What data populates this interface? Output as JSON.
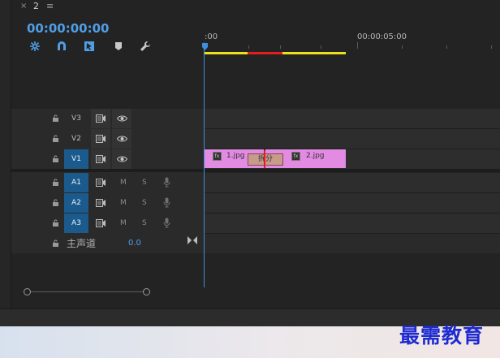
{
  "panel": {
    "close_glyph": "×",
    "tab_name": "2",
    "menu_glyph": "≡",
    "timecode": "00:00:00:00"
  },
  "tools": [
    "snap-icon",
    "magnet-icon",
    "linked-selection-icon",
    "marker-icon",
    "wrench-icon"
  ],
  "ruler": {
    "start_label": ":00",
    "mid_label": "00:00:05:00"
  },
  "tracks": {
    "video": [
      {
        "label": "V3",
        "selected": false
      },
      {
        "label": "V2",
        "selected": false
      },
      {
        "label": "V1",
        "selected": true
      }
    ],
    "audio": [
      {
        "label": "A1",
        "m": "M",
        "s": "S"
      },
      {
        "label": "A2",
        "m": "M",
        "s": "S"
      },
      {
        "label": "A3",
        "m": "M",
        "s": "S"
      }
    ],
    "master": {
      "label": "主声道",
      "value": "0.0"
    }
  },
  "clips": {
    "clip1": {
      "fx": "fx",
      "label": "1.jpg"
    },
    "clip2": {
      "fx": "fx",
      "label": "2.jpg"
    },
    "transition": {
      "label": "拆分"
    }
  },
  "colors": {
    "accent": "#4f9fe6",
    "clip": "#e38ae3",
    "playhead_red": "#e81c1c",
    "work_yellow": "#e8e21a"
  },
  "watermark": "最需教育"
}
